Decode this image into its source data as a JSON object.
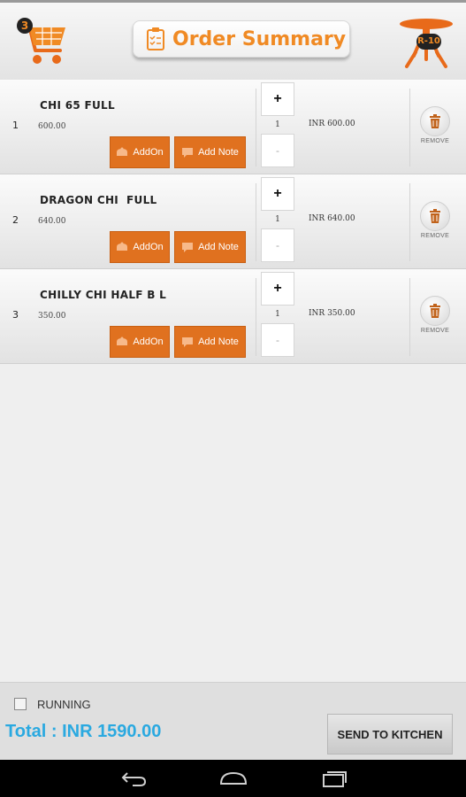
{
  "header": {
    "cart_count": "3",
    "title": "Order Summary",
    "table_label": "R-10"
  },
  "items": [
    {
      "index": "1",
      "name": "CHI 65 FULL",
      "price": "600.00",
      "qty": "1",
      "line_total": "INR 600.00"
    },
    {
      "index": "2",
      "name": "DRAGON CHI  FULL",
      "price": "640.00",
      "qty": "1",
      "line_total": "INR 640.00"
    },
    {
      "index": "3",
      "name": "CHILLY CHI HALF B L",
      "price": "350.00",
      "qty": "1",
      "line_total": "INR 350.00"
    }
  ],
  "labels": {
    "addon": "AddOn",
    "add_note": "Add Note",
    "plus": "+",
    "minus": "-",
    "remove": "REMOVE"
  },
  "footer": {
    "running": "RUNNING",
    "total": "Total : INR 1590.00",
    "send": "SEND TO KITCHEN"
  },
  "colors": {
    "accent": "#f08a24",
    "button": "#e0711f",
    "total": "#2aa9e0"
  },
  "icons": [
    "cart-icon",
    "clipboard-icon",
    "table-icon",
    "addon-icon",
    "note-icon",
    "trash-icon",
    "back-icon",
    "home-icon",
    "recents-icon"
  ]
}
